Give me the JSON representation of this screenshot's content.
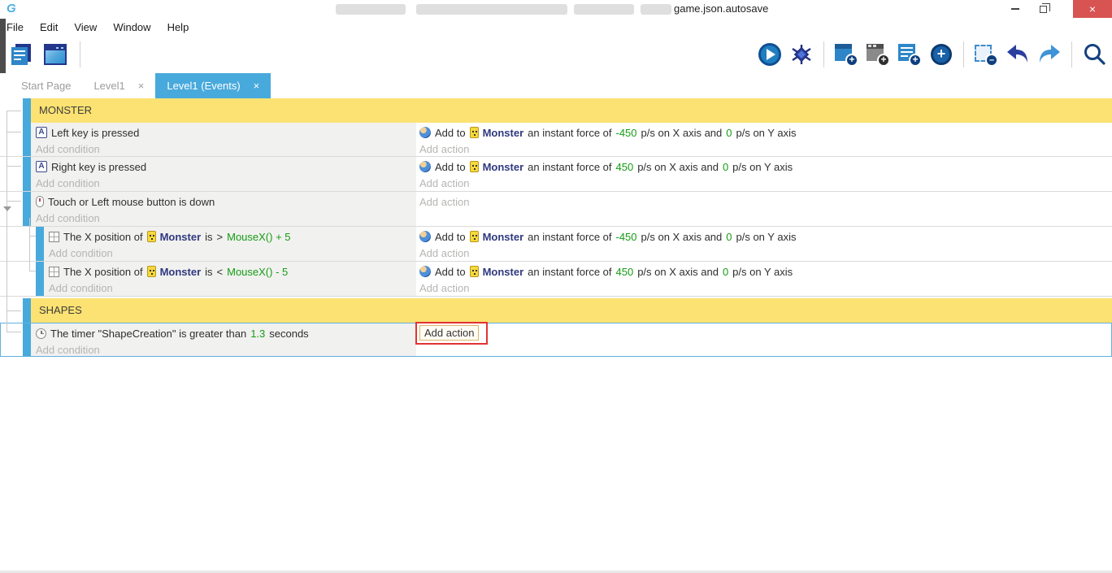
{
  "colors": {
    "accent_blue": "#48a9dc",
    "group_yellow": "#fbe272",
    "value_green": "#159c15",
    "object_navy": "#30397f",
    "selection_blue": "#5fb2e0",
    "annotation_red": "#e23333",
    "close_button_red": "#d75452"
  },
  "window": {
    "title_visible": "game.json.autosave",
    "close_glyph": "×"
  },
  "menu": {
    "file": "File",
    "edit": "Edit",
    "view": "View",
    "window": "Window",
    "help": "Help"
  },
  "toolbar_icons": [
    "project-manager-icon",
    "scene-editor-icon",
    "play-icon",
    "debug-bug-icon",
    "add-event-icon",
    "add-comment-icon",
    "add-subevent-icon",
    "add-other-event-icon",
    "delete-selection-icon",
    "undo-icon",
    "redo-icon",
    "search-icon"
  ],
  "tabs": {
    "start": "Start Page",
    "level1": "Level1",
    "events": "Level1 (Events)",
    "close_glyph": "×"
  },
  "sheet": {
    "placeholders": {
      "condition": "Add condition",
      "action": "Add action"
    },
    "groups": {
      "monster": "MONSTER",
      "shapes": "SHAPES"
    },
    "ev_left": {
      "cond": "Left key is pressed"
    },
    "ev_right": {
      "cond": "Right key is pressed"
    },
    "ev_touch": {
      "cond": "Touch or Left mouse button is down"
    },
    "force_left": {
      "p1": "Add to",
      "obj": "Monster",
      "p2": "an instant force of",
      "v1": "-450",
      "p3": "p/s on X axis and",
      "v2": "0",
      "p4": "p/s on Y axis"
    },
    "force_right": {
      "p1": "Add to",
      "obj": "Monster",
      "p2": "an instant force of",
      "v1": "450",
      "p3": "p/s on X axis and",
      "v2": "0",
      "p4": "p/s on Y axis"
    },
    "sub_gt": {
      "c1": "The X position of",
      "obj": "Monster",
      "c2": "is",
      "op": ">",
      "expr": "MouseX() + 5"
    },
    "sub_lt": {
      "c1": "The X position of",
      "obj": "Monster",
      "c2": "is",
      "op": "<",
      "expr": "MouseX() - 5"
    },
    "timer": {
      "c1": "The timer \"ShapeCreation\" is greater than",
      "v": "1.3",
      "c2": "seconds"
    }
  }
}
